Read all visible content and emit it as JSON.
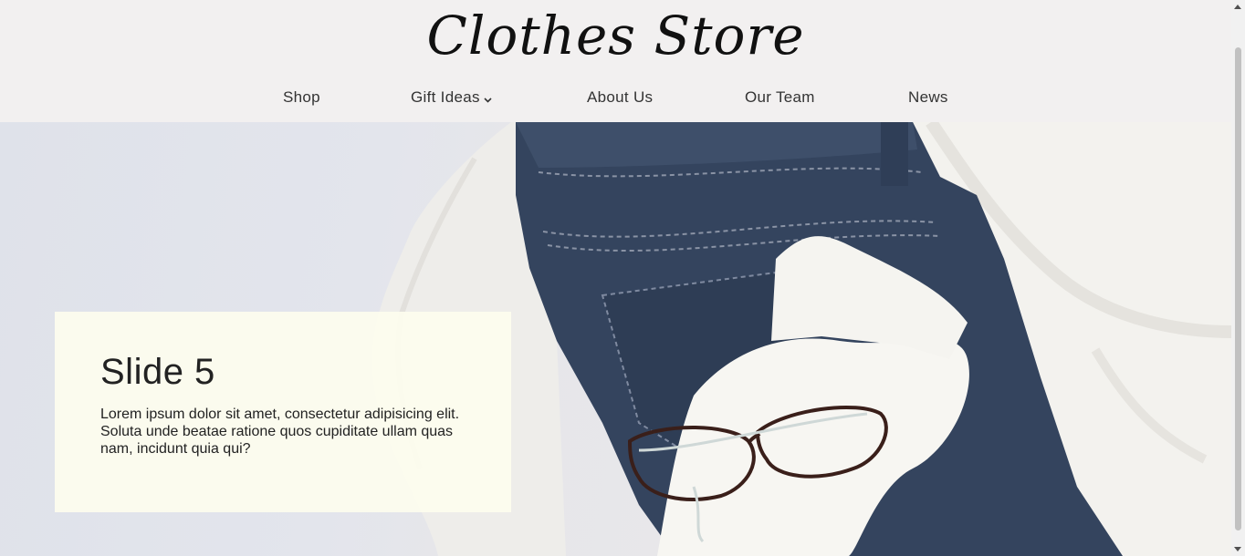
{
  "header": {
    "logo": "Clothes Store"
  },
  "nav": {
    "items": [
      {
        "label": "Shop"
      },
      {
        "label": "Gift Ideas",
        "has_dropdown": true
      },
      {
        "label": "About Us"
      },
      {
        "label": "Our Team"
      },
      {
        "label": "News"
      }
    ]
  },
  "hero": {
    "image_description_icon": "clothes-photo",
    "slide": {
      "title": "Slide 5",
      "text": "Lorem ipsum dolor sit amet, consectetur adipisicing elit. Soluta unde beatae ratione quos cupiditate ullam quas nam, incidunt quia qui?"
    }
  },
  "colors": {
    "header_bg": "#f2f0f0",
    "slide_box_bg": "#fdfdee",
    "denim": "#34445e",
    "knit": "#f3f2ee"
  }
}
